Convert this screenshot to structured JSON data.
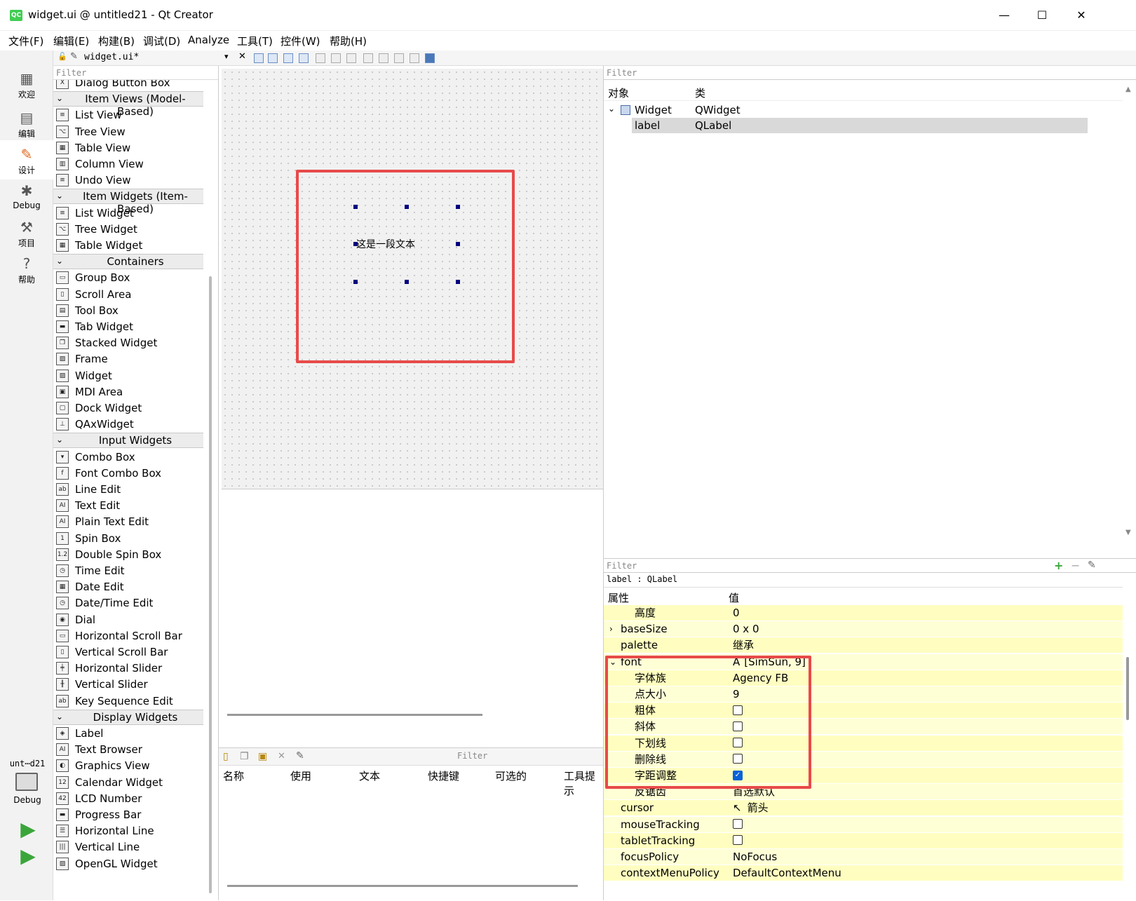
{
  "window": {
    "title": "widget.ui @ untitled21 - Qt Creator",
    "logo": "QC"
  },
  "menu": [
    "文件(F)",
    "编辑(E)",
    "构建(B)",
    "调试(D)",
    "Analyze",
    "工具(T)",
    "控件(W)",
    "帮助(H)"
  ],
  "modes": [
    {
      "label": "欢迎",
      "icon": "grid-icon"
    },
    {
      "label": "编辑",
      "icon": "document-icon"
    },
    {
      "label": "设计",
      "icon": "pencil-icon"
    },
    {
      "label": "Debug",
      "icon": "bug-icon"
    },
    {
      "label": "项目",
      "icon": "wrench-icon"
    },
    {
      "label": "帮助",
      "icon": "help-icon"
    }
  ],
  "kit": {
    "project": "unt⋯d21",
    "config": "Debug"
  },
  "editor": {
    "file": "widget.ui*"
  },
  "widgetbox": {
    "filter_placeholder": "Filter",
    "entries": [
      {
        "type": "item",
        "label": "Dialog Button Box",
        "icon": "X"
      },
      {
        "type": "cat",
        "label": "Item Views (Model-Based)"
      },
      {
        "type": "item",
        "label": "List View",
        "icon": "≡"
      },
      {
        "type": "item",
        "label": "Tree View",
        "icon": "⌥"
      },
      {
        "type": "item",
        "label": "Table View",
        "icon": "▦"
      },
      {
        "type": "item",
        "label": "Column View",
        "icon": "▥"
      },
      {
        "type": "item",
        "label": "Undo View",
        "icon": "≡"
      },
      {
        "type": "cat",
        "label": "Item Widgets (Item-Based)"
      },
      {
        "type": "item",
        "label": "List Widget",
        "icon": "≡"
      },
      {
        "type": "item",
        "label": "Tree Widget",
        "icon": "⌥"
      },
      {
        "type": "item",
        "label": "Table Widget",
        "icon": "▦"
      },
      {
        "type": "cat",
        "label": "Containers"
      },
      {
        "type": "item",
        "label": "Group Box",
        "icon": "▭"
      },
      {
        "type": "item",
        "label": "Scroll Area",
        "icon": "▯"
      },
      {
        "type": "item",
        "label": "Tool Box",
        "icon": "▤"
      },
      {
        "type": "item",
        "label": "Tab Widget",
        "icon": "▬"
      },
      {
        "type": "item",
        "label": "Stacked Widget",
        "icon": "❐"
      },
      {
        "type": "item",
        "label": "Frame",
        "icon": "▨"
      },
      {
        "type": "item",
        "label": "Widget",
        "icon": "▨"
      },
      {
        "type": "item",
        "label": "MDI Area",
        "icon": "▣"
      },
      {
        "type": "item",
        "label": "Dock Widget",
        "icon": "▢"
      },
      {
        "type": "item",
        "label": "QAxWidget",
        "icon": "⊥"
      },
      {
        "type": "cat",
        "label": "Input Widgets"
      },
      {
        "type": "item",
        "label": "Combo Box",
        "icon": "▾"
      },
      {
        "type": "item",
        "label": "Font Combo Box",
        "icon": "f"
      },
      {
        "type": "item",
        "label": "Line Edit",
        "icon": "ab"
      },
      {
        "type": "item",
        "label": "Text Edit",
        "icon": "AI"
      },
      {
        "type": "item",
        "label": "Plain Text Edit",
        "icon": "AI"
      },
      {
        "type": "item",
        "label": "Spin Box",
        "icon": "1"
      },
      {
        "type": "item",
        "label": "Double Spin Box",
        "icon": "1.2"
      },
      {
        "type": "item",
        "label": "Time Edit",
        "icon": "◷"
      },
      {
        "type": "item",
        "label": "Date Edit",
        "icon": "▦"
      },
      {
        "type": "item",
        "label": "Date/Time Edit",
        "icon": "◷"
      },
      {
        "type": "item",
        "label": "Dial",
        "icon": "◉"
      },
      {
        "type": "item",
        "label": "Horizontal Scroll Bar",
        "icon": "▭"
      },
      {
        "type": "item",
        "label": "Vertical Scroll Bar",
        "icon": "▯"
      },
      {
        "type": "item",
        "label": "Horizontal Slider",
        "icon": "╪"
      },
      {
        "type": "item",
        "label": "Vertical Slider",
        "icon": "╫"
      },
      {
        "type": "item",
        "label": "Key Sequence Edit",
        "icon": "ab"
      },
      {
        "type": "cat",
        "label": "Display Widgets"
      },
      {
        "type": "item",
        "label": "Label",
        "icon": "◈"
      },
      {
        "type": "item",
        "label": "Text Browser",
        "icon": "AI"
      },
      {
        "type": "item",
        "label": "Graphics View",
        "icon": "◐"
      },
      {
        "type": "item",
        "label": "Calendar Widget",
        "icon": "12"
      },
      {
        "type": "item",
        "label": "LCD Number",
        "icon": "42"
      },
      {
        "type": "item",
        "label": "Progress Bar",
        "icon": "▬"
      },
      {
        "type": "item",
        "label": "Horizontal Line",
        "icon": "☰"
      },
      {
        "type": "item",
        "label": "Vertical Line",
        "icon": "|||"
      },
      {
        "type": "item",
        "label": "OpenGL Widget",
        "icon": "▨"
      }
    ]
  },
  "form": {
    "label_text": "这是一段文本"
  },
  "actions": {
    "filter_placeholder": "Filter",
    "columns": [
      "名称",
      "使用",
      "文本",
      "快捷键",
      "可选的",
      "工具提示"
    ]
  },
  "object_inspector": {
    "filter_placeholder": "Filter",
    "columns": [
      "对象",
      "类"
    ],
    "rows": [
      {
        "object": "Widget",
        "class": "QWidget"
      },
      {
        "object": "label",
        "class": "QLabel"
      }
    ]
  },
  "property_editor": {
    "filter_placeholder": "Filter",
    "context": "label : QLabel",
    "columns": [
      "属性",
      "值"
    ],
    "rows": [
      {
        "name": "高度",
        "value": "0",
        "level": 1
      },
      {
        "name": "baseSize",
        "value": "0 x 0",
        "level": 0,
        "expander": "›"
      },
      {
        "name": "palette",
        "value": "继承",
        "level": 0
      },
      {
        "name": "font",
        "value": "[SimSun, 9]",
        "level": 0,
        "expander": "⌄"
      },
      {
        "name": "字体族",
        "value": "Agency FB",
        "level": 1
      },
      {
        "name": "点大小",
        "value": "9",
        "level": 1
      },
      {
        "name": "粗体",
        "value": "",
        "level": 1,
        "check": false
      },
      {
        "name": "斜体",
        "value": "",
        "level": 1,
        "check": false
      },
      {
        "name": "下划线",
        "value": "",
        "level": 1,
        "check": false
      },
      {
        "name": "删除线",
        "value": "",
        "level": 1,
        "check": false
      },
      {
        "name": "字距调整",
        "value": "",
        "level": 1,
        "check": true
      },
      {
        "name": "反锯齿",
        "value": "首选默认",
        "level": 1
      },
      {
        "name": "cursor",
        "value": "箭头",
        "level": 0
      },
      {
        "name": "mouseTracking",
        "value": "",
        "level": 0,
        "check": false
      },
      {
        "name": "tabletTracking",
        "value": "",
        "level": 0,
        "check": false
      },
      {
        "name": "focusPolicy",
        "value": "NoFocus",
        "level": 0
      },
      {
        "name": "contextMenuPolicy",
        "value": "DefaultContextMenu",
        "level": 0
      }
    ]
  },
  "colors": {
    "highlight": "#e84a4a",
    "row_yellow": "#ffffd6",
    "row_yellow_alt": "#fffec0",
    "selection": "#d9d9d9",
    "handle": "#000080"
  }
}
